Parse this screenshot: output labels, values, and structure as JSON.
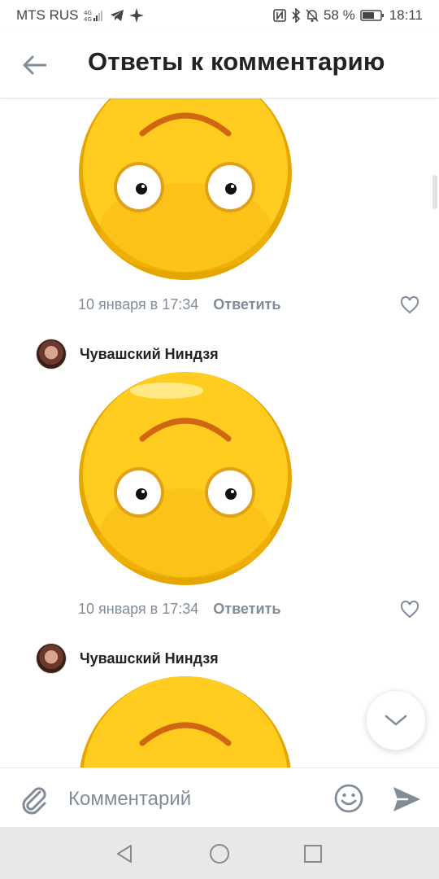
{
  "status_bar": {
    "carrier": "MTS RUS",
    "battery": "58 %",
    "time": "18:11"
  },
  "header": {
    "title": "Ответы к комментарию"
  },
  "comments": [
    {
      "date": "10 января в 17:34",
      "reply_label": "Ответить"
    },
    {
      "author": "Чувашский Ниндзя",
      "date": "10 января в 17:34",
      "reply_label": "Ответить"
    },
    {
      "author": "Чувашский Ниндзя"
    }
  ],
  "composer": {
    "placeholder": "Комментарий"
  },
  "colors": {
    "accent": "#818c99",
    "sticker_face": "#ffcc1f",
    "sticker_rim": "#e5a600"
  }
}
